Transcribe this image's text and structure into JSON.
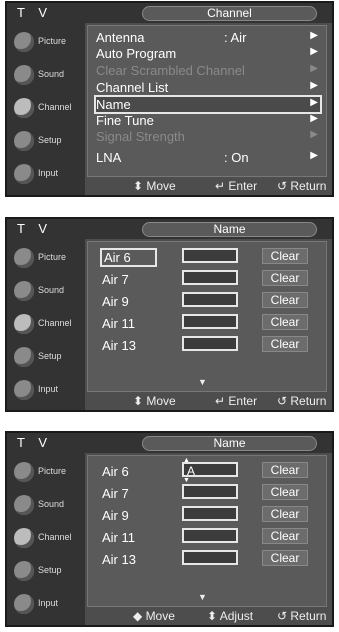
{
  "app_title": "T V",
  "sidebar": [
    {
      "label": "Picture"
    },
    {
      "label": "Sound"
    },
    {
      "label": "Channel"
    },
    {
      "label": "Setup"
    },
    {
      "label": "Input"
    }
  ],
  "screen1": {
    "title": "Channel",
    "items": [
      {
        "label": "Antenna",
        "value": ": Air",
        "dim": false
      },
      {
        "label": "Auto Program",
        "value": "",
        "dim": false
      },
      {
        "label": "Clear Scrambled Channel",
        "value": "",
        "dim": true
      },
      {
        "label": "Channel List",
        "value": "",
        "dim": false
      },
      {
        "label": "Name",
        "value": "",
        "dim": false
      },
      {
        "label": "Fine Tune",
        "value": "",
        "dim": false
      },
      {
        "label": "Signal Strength",
        "value": "",
        "dim": true
      },
      {
        "label": "LNA",
        "value": ": On",
        "dim": false
      }
    ],
    "footer": [
      "⬍ Move",
      "↵ Enter",
      "↺ Return"
    ]
  },
  "screen2": {
    "title": "Name",
    "rows": [
      {
        "channel": "Air 6",
        "name": "",
        "clear": "Clear"
      },
      {
        "channel": "Air 7",
        "name": "",
        "clear": "Clear"
      },
      {
        "channel": "Air 9",
        "name": "",
        "clear": "Clear"
      },
      {
        "channel": "Air 11",
        "name": "",
        "clear": "Clear"
      },
      {
        "channel": "Air 13",
        "name": "",
        "clear": "Clear"
      }
    ],
    "footer": [
      "⬍ Move",
      "↵ Enter",
      "↺ Return"
    ]
  },
  "screen3": {
    "title": "Name",
    "rows": [
      {
        "channel": "Air 6",
        "name": "A",
        "clear": "Clear"
      },
      {
        "channel": "Air 7",
        "name": "",
        "clear": "Clear"
      },
      {
        "channel": "Air 9",
        "name": "",
        "clear": "Clear"
      },
      {
        "channel": "Air 11",
        "name": "",
        "clear": "Clear"
      },
      {
        "channel": "Air 13",
        "name": "",
        "clear": "Clear"
      }
    ],
    "footer": [
      "◆ Move",
      "⬍ Adjust",
      "↺ Return"
    ]
  }
}
